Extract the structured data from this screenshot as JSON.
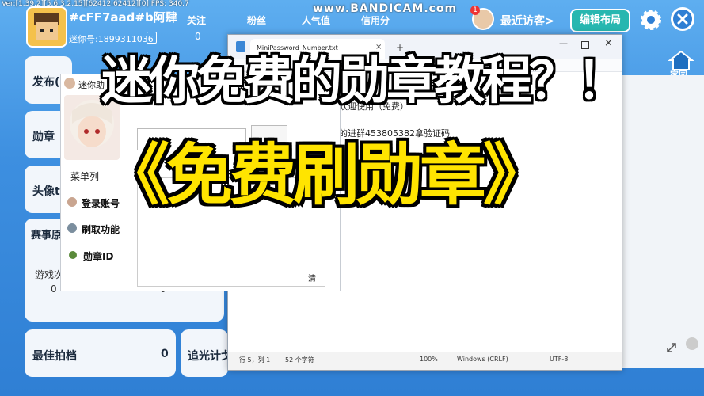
{
  "recorder": {
    "stats": "Ver:[1.39.2][5.6.3.2.15][62412.62412][0] FPS: 340.7",
    "watermark": "www.BANDICAM.com"
  },
  "profile": {
    "name": "#cFF7aad#b阿肆",
    "id": "迷你号:1899311036"
  },
  "stats": [
    {
      "label": "关注",
      "value": "0"
    },
    {
      "label": "粉丝",
      "value": ""
    },
    {
      "label": "人气值",
      "value": ""
    },
    {
      "label": "信用分",
      "value": ""
    }
  ],
  "visitors": {
    "badge": "1",
    "label": "最近访客>"
  },
  "edit_layout": "编辑布局",
  "home": {
    "label": "家园"
  },
  "cards": {
    "publish": "发布(",
    "badge": "勋章",
    "avatar": "头像t",
    "season": "赛事原",
    "game_label": "游戏次",
    "left_val": "0",
    "right_val": "0",
    "best_photo": "最佳拍档",
    "best_photo_val": "0",
    "chase_light": "追光计戈"
  },
  "notepad": {
    "tab_title": "MiniPassword_Number.txt",
    "add_tab": "+",
    "line1": "欢迎使用（免费）",
    "line2": "的进群453805382拿验证码",
    "status": {
      "position": "行 5，列 1",
      "chars": "52 个字符",
      "zoom": "100%",
      "eol": "Windows (CRLF)",
      "encoding": "UTF-8"
    }
  },
  "tool": {
    "title": "迷你助",
    "menu_title": "菜单列",
    "items": [
      "登录账号",
      "刷取功能",
      "勋章ID"
    ],
    "clear_button": "清"
  },
  "overlay": {
    "headline": "迷你免费的勋章教程？！",
    "subhead": "《免费刷勋章》"
  }
}
